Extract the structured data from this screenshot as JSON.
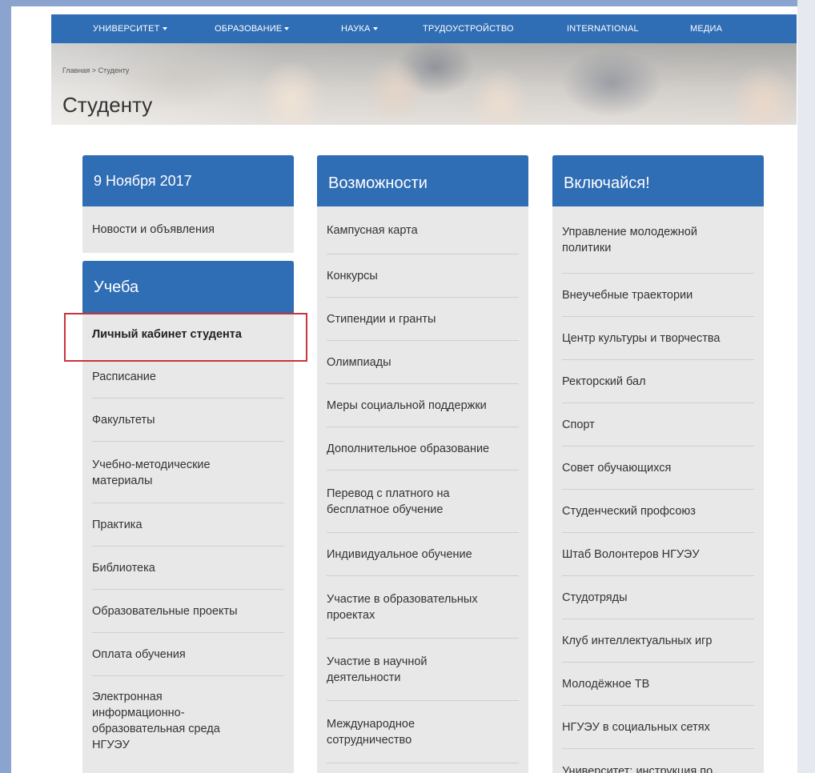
{
  "nav": {
    "items": [
      {
        "label": "УНИВЕРСИТЕТ",
        "dropdown": true
      },
      {
        "label": "ОБРАЗОВАНИЕ",
        "dropdown": true
      },
      {
        "label": "НАУКА",
        "dropdown": true
      },
      {
        "label": "ТРУДОУСТРОЙСТВО",
        "dropdown": false
      },
      {
        "label": "INTERNATIONAL",
        "dropdown": false
      },
      {
        "label": "МЕДИА",
        "dropdown": false
      }
    ]
  },
  "breadcrumb": {
    "home": "Главная",
    "separator": ">",
    "current": "Студенту"
  },
  "page_title": "Студенту",
  "col1": {
    "date_header": "9 Ноября 2017",
    "news_link": "Новости и объявления",
    "study_header": "Учеба",
    "items": [
      "Личный кабинет студента",
      "Расписание",
      "Факультеты",
      "Учебно-методические материалы",
      "Практика",
      "Библиотека",
      "Образовательные проекты",
      "Оплата обучения",
      "Электронная информационно-образовательная среда НГУЭУ"
    ]
  },
  "col2": {
    "header": "Возможности",
    "items": [
      "Кампусная карта",
      "Конкурсы",
      "Стипендии и гранты",
      "Олимпиады",
      "Меры социальной поддержки",
      "Дополнительное образование",
      "Перевод с платного на бесплатное обучение",
      "Индивидуальное обучение",
      "Участие в образовательных проектах",
      "Участие в научной деятельности",
      "Международное сотрудничество"
    ]
  },
  "col3": {
    "header": "Включайся!",
    "items": [
      "Управление молодежной политики",
      "Внеучебные траектории",
      "Центр культуры и творчества",
      "Ректорский бал",
      "Спорт",
      "Совет обучающихся",
      "Студенческий профсоюз",
      "Штаб Волонтеров НГУЭУ",
      "Студотряды",
      "Клуб интеллектуальных игр",
      "Молодёжное ТВ",
      "НГУЭУ в социальных сетях",
      "Университет: инструкция по"
    ]
  },
  "colors": {
    "nav_blue": "#2f6db5",
    "header_blue": "#2f6db5",
    "panel_gray": "#e8e8e8",
    "highlight_red": "#c8343a",
    "frame_blue": "#8aa3cf"
  },
  "icons": {
    "dropdown": "caret-down-icon"
  }
}
